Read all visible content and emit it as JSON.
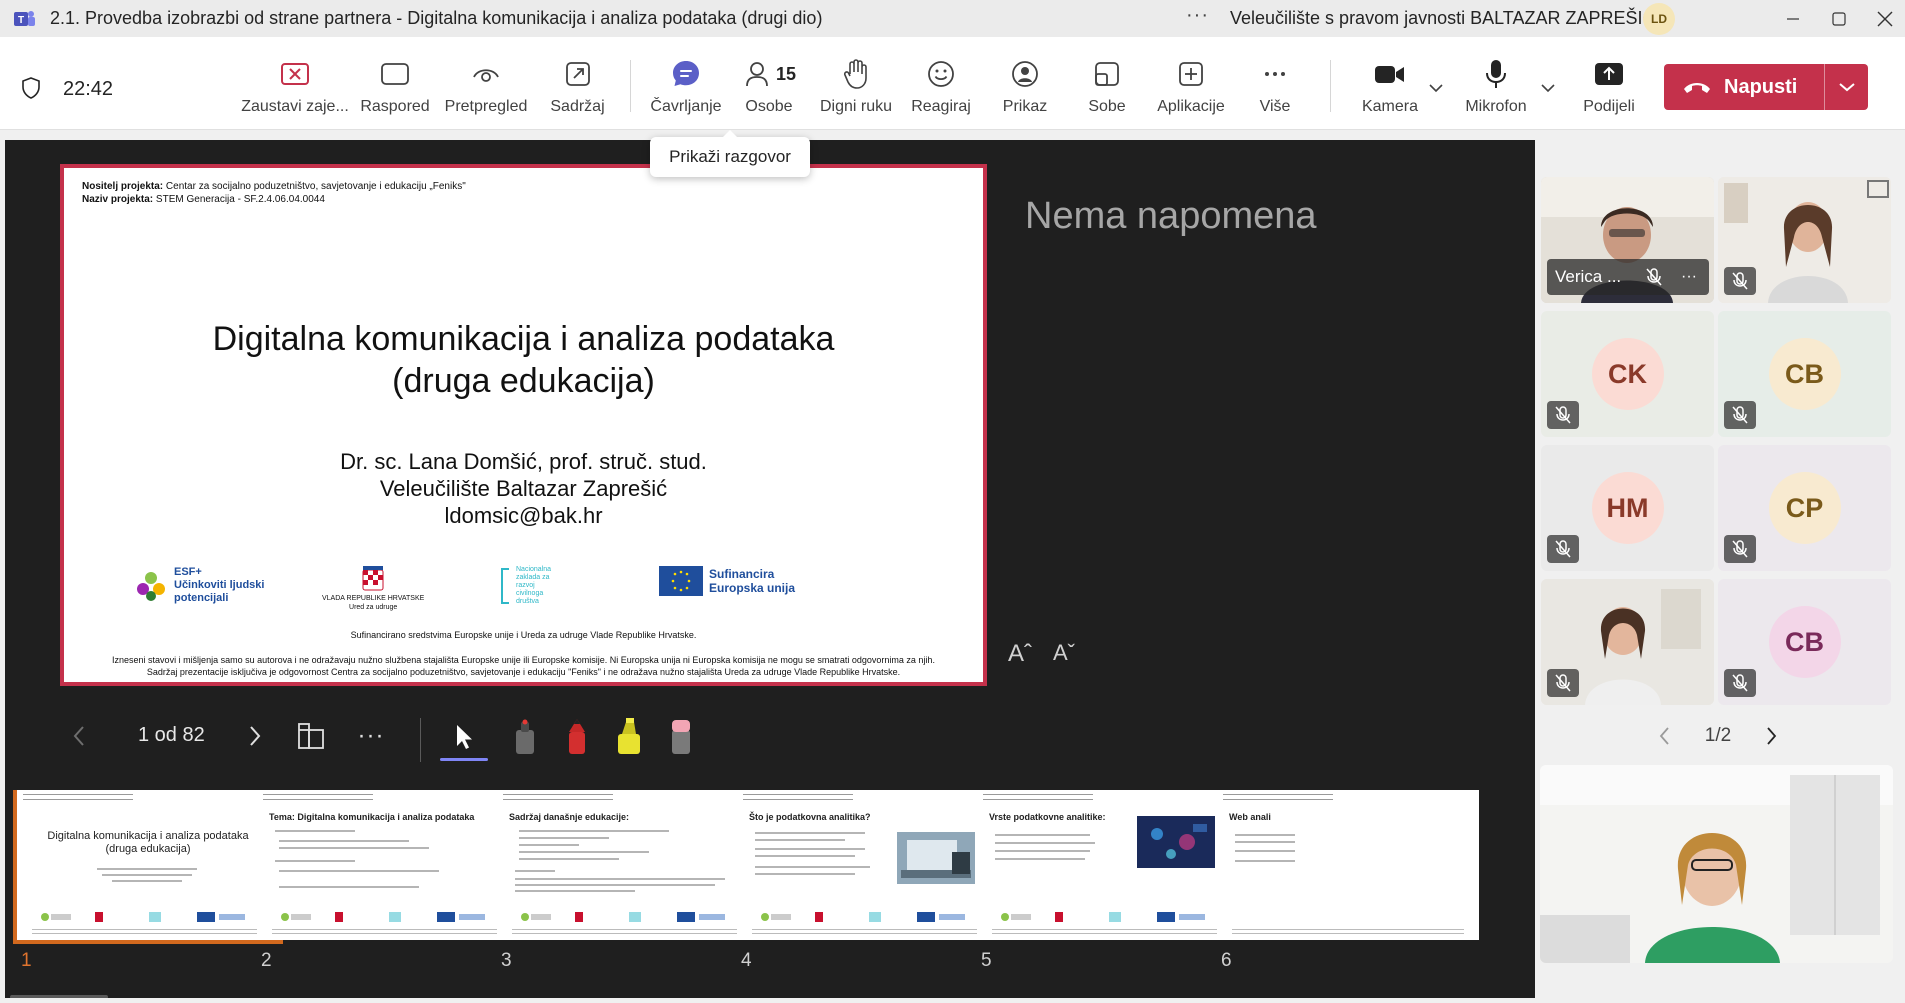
{
  "window": {
    "title": "2.1. Provedba izobrazbi od strane partnera - Digitalna komunikacija i analiza podataka (drugi dio)",
    "more": "···",
    "org": "Veleučilište s pravom javnosti BALTAZAR ZAPREŠIĆ",
    "user_initials": "LD"
  },
  "toolbar": {
    "timer": "22:42",
    "buttons": [
      {
        "label": "Zaustavi zaje..."
      },
      {
        "label": "Raspored"
      },
      {
        "label": "Pretpregled"
      },
      {
        "label": "Sadržaj"
      },
      {
        "label": "Čavrljanje"
      },
      {
        "label": "Osobe",
        "count": "15"
      },
      {
        "label": "Digni ruku"
      },
      {
        "label": "Reagiraj"
      },
      {
        "label": "Prikaz"
      },
      {
        "label": "Sobe"
      },
      {
        "label": "Aplikacije"
      },
      {
        "label": "Više"
      },
      {
        "label": "Kamera"
      },
      {
        "label": "Mikrofon"
      },
      {
        "label": "Podijeli"
      }
    ],
    "leave_label": "Napusti",
    "accent": "#c4314b"
  },
  "tooltip": "Prikaži razgovor",
  "slide": {
    "header_line1_bold": "Nositelj projekta:",
    "header_line1": " Centar za socijalno poduzetništvo, savjetovanje i edukaciju „Feniks\"",
    "header_line2_bold": "Naziv projekta:",
    "header_line2": " STEM Generacija - SF.2.4.06.04.0044",
    "title_line1": "Digitalna komunikacija i analiza podataka",
    "title_line2": "(druga edukacija)",
    "author_line1": "Dr. sc. Lana Domšić, prof. struč. stud.",
    "author_line2": "Veleučilište Baltazar Zaprešić",
    "author_line3": "ldomsic@bak.hr",
    "logo_esf_top": "ESF+",
    "logo_esf_line1": "Učinkoviti ljudski",
    "logo_esf_line2": "potencijali",
    "logo_gov_line1": "VLADA REPUBLIKE HRVATSKE",
    "logo_gov_line2": "Ured za udruge",
    "logo_nz_line1": "Nacionalna",
    "logo_nz_line2": "zaklada za",
    "logo_nz_line3": "razvoj",
    "logo_nz_line4": "civilnoga",
    "logo_nz_line5": "društva",
    "logo_eu_line1": "Sufinancira",
    "logo_eu_line2": "Europska unija",
    "funding": "Sufinancirano sredstvima Europske unije i Ureda za udruge Vlade Republike Hrvatske.",
    "disclaimer1": "Izneseni stavovi i mišljenja samo su autorova i ne odražavaju nužno službena stajališta Europske unije ili Europske komisije. Ni Europska unija ni Europska komisija ne mogu se smatrati odgovornima za njih.",
    "disclaimer2": "Sadržaj prezentacije isključiva je odgovornost Centra za socijalno poduzetništvo, savjetovanje i edukaciju \"Feniks\" i ne odražava nužno stajališta Ureda za udruge Vlade Republike Hrvatske."
  },
  "notes": "Nema napomena",
  "font_controls": {
    "increase": "Aˆ",
    "decrease": "Aˇ"
  },
  "controls": {
    "counter": "1 od 82",
    "more": "···"
  },
  "thumbnails": [
    {
      "number": "1",
      "title_line1": "Digitalna komunikacija i analiza podataka",
      "title_line2": "(druga edukacija)"
    },
    {
      "number": "2",
      "title": "Tema: Digitalna komunikacija i analiza podataka"
    },
    {
      "number": "3",
      "title": "Sadržaj današnje edukacije:"
    },
    {
      "number": "4",
      "title": "Što je podatkovna analitika?"
    },
    {
      "number": "5",
      "title": "Vrste podatkovne analitike:"
    },
    {
      "number": "6",
      "title": "Web anali"
    }
  ],
  "participants": {
    "tiles": [
      {
        "name": "Verica ...",
        "type": "video"
      },
      {
        "type": "video"
      },
      {
        "initials": "CK",
        "bg": "#fbdbd4",
        "fg": "#8a3a2a"
      },
      {
        "initials": "CB",
        "bg": "#f8ead0",
        "fg": "#7a5a1a"
      },
      {
        "initials": "HM",
        "bg": "#fbdbd4",
        "fg": "#8a3a2a"
      },
      {
        "initials": "CP",
        "bg": "#f8ead0",
        "fg": "#7a5a1a"
      },
      {
        "type": "video"
      },
      {
        "initials": "CB",
        "bg": "#f3d6e8",
        "fg": "#7a2a5a"
      }
    ],
    "pager": "1/2"
  }
}
